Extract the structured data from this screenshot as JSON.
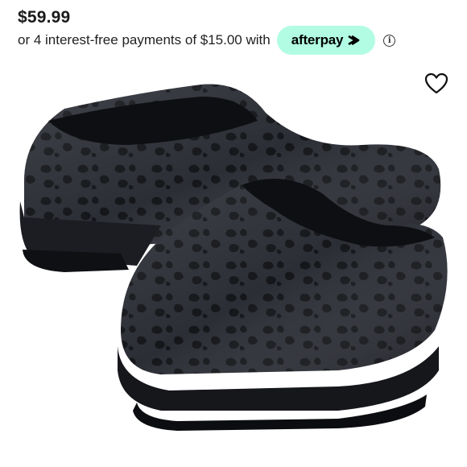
{
  "product": {
    "price": "$59.99",
    "installment_text": "or 4 interest-free payments of $15.00 with",
    "afterpay_label": "afterpay",
    "info_glyph": "i",
    "image_subject": "black leopard-print clogs",
    "wishlist_icon": "heart-outline-icon"
  },
  "colors": {
    "afterpay_mint": "#b2fce4",
    "shoe_base": "#2a2c33",
    "shoe_sole": "#1a1b20",
    "print": "#15161a"
  }
}
